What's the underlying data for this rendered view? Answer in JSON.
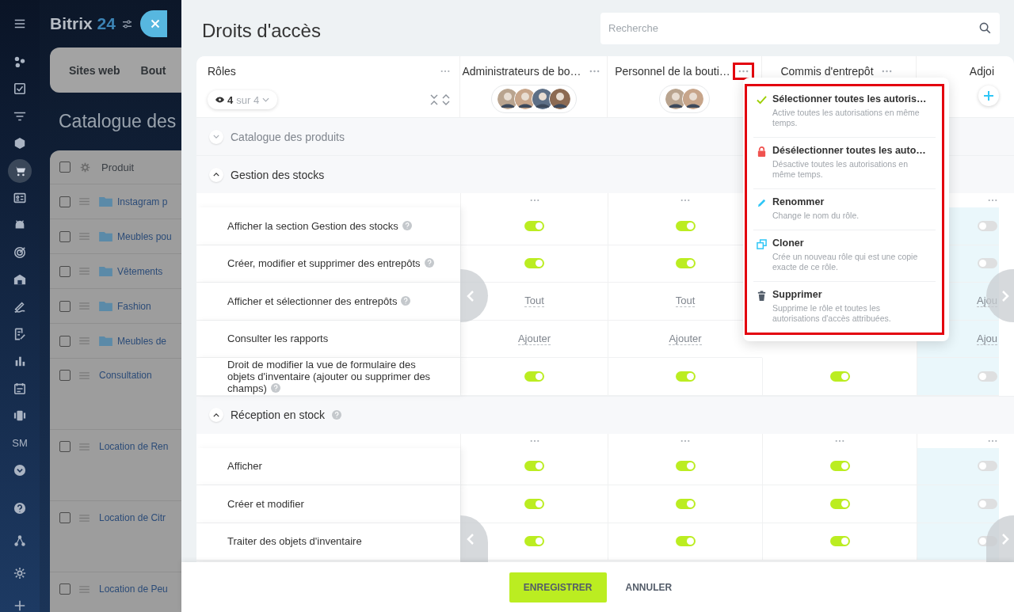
{
  "sidebar": {
    "groups": [
      [
        {
          "kind": "menu",
          "selected": false
        }
      ],
      [
        {
          "kind": "dots",
          "selected": false
        },
        {
          "kind": "task",
          "selected": false
        },
        {
          "kind": "funnel",
          "selected": false
        },
        {
          "kind": "cube",
          "selected": false
        },
        {
          "kind": "cart",
          "selected": true
        },
        {
          "kind": "contact",
          "selected": false
        },
        {
          "kind": "robot",
          "selected": false
        },
        {
          "kind": "target",
          "selected": false
        },
        {
          "kind": "building",
          "selected": false
        },
        {
          "kind": "signature",
          "selected": false
        },
        {
          "kind": "document",
          "selected": false
        },
        {
          "kind": "chart",
          "selected": false
        },
        {
          "kind": "calendar",
          "selected": false
        },
        {
          "kind": "video",
          "selected": false
        },
        {
          "kind": "text",
          "label": "SM",
          "selected": false
        },
        {
          "kind": "chevron",
          "selected": false
        }
      ],
      [
        {
          "kind": "help",
          "selected": false
        },
        {
          "kind": "network",
          "selected": false
        },
        {
          "kind": "settings",
          "selected": false
        },
        {
          "kind": "plus",
          "selected": false
        }
      ]
    ]
  },
  "page": {
    "logo": "Bitrix",
    "logo_number": "24",
    "tabs": [
      "Sites web",
      "Bout"
    ],
    "title": "Catalogue des",
    "table": {
      "header": "Produit",
      "all_checked": false,
      "rows": [
        {
          "name": "Instagram p",
          "kind": "folder",
          "checked": false
        },
        {
          "name": "Meubles pou",
          "kind": "folder",
          "checked": false
        },
        {
          "name": "Vêtements",
          "kind": "folder",
          "checked": false
        },
        {
          "name": "Fashion",
          "kind": "folder",
          "checked": false
        },
        {
          "name": "Meubles de",
          "kind": "folder",
          "checked": false
        },
        {
          "name": "Consultation",
          "kind": "product",
          "checked": false
        },
        {
          "name": "Location de Ren",
          "kind": "product",
          "checked": false
        },
        {
          "name": "Location de Citr",
          "kind": "product",
          "checked": false
        },
        {
          "name": "Location de Peu",
          "kind": "product",
          "checked": false
        }
      ]
    }
  },
  "panel": {
    "title": "Droits d'accès",
    "search": {
      "placeholder": "Recherche"
    },
    "roles_header": {
      "label": "Rôles",
      "count": "4",
      "total": "sur 4"
    },
    "roles": [
      {
        "name": "Administrateurs de bo…",
        "kind": "members",
        "highlighted": false,
        "tinted": false
      },
      {
        "name": "Personnel de la bouti…",
        "kind": "members",
        "highlighted": true,
        "tinted": false
      },
      {
        "name": "Commis d'entrepôt",
        "kind": "hidden",
        "highlighted": false,
        "tinted": false
      },
      {
        "name": "Adjoi",
        "kind": "empty",
        "tinted": true
      }
    ],
    "sections": [
      {
        "title": "Catalogue des produits",
        "expanded": false,
        "help": false
      },
      {
        "title": "Gestion des stocks",
        "expanded": true,
        "help": false,
        "rows": [
          {
            "label": "Afficher la section Gestion des stocks",
            "help": true,
            "cells": [
              {
                "kind": "toggle",
                "on": true
              },
              {
                "kind": "toggle",
                "on": true
              },
              null,
              {
                "kind": "toggle",
                "on": false
              }
            ]
          },
          {
            "label": "Créer, modifier et supprimer des entrepôts",
            "help": true,
            "cells": [
              {
                "kind": "toggle",
                "on": true
              },
              {
                "kind": "toggle",
                "on": true
              },
              null,
              {
                "kind": "toggle",
                "on": false
              }
            ]
          },
          {
            "label": "Afficher et sélectionner des entrepôts",
            "help": true,
            "cells": [
              {
                "kind": "link",
                "text": "Tout"
              },
              {
                "kind": "link",
                "text": "Tout"
              },
              null,
              {
                "kind": "link",
                "text": "Ajou"
              }
            ]
          },
          {
            "label": "Consulter les rapports",
            "help": false,
            "cells": [
              {
                "kind": "link",
                "text": "Ajouter"
              },
              {
                "kind": "link",
                "text": "Ajouter"
              },
              null,
              {
                "kind": "link",
                "text": "Ajou"
              }
            ]
          },
          {
            "label": "Droit de modifier la vue de formulaire des objets d'inventaire (ajouter ou supprimer des champs)",
            "help": true,
            "cells": [
              {
                "kind": "toggle",
                "on": true
              },
              {
                "kind": "toggle",
                "on": true
              },
              {
                "kind": "toggle",
                "on": true
              },
              {
                "kind": "toggle",
                "on": false
              }
            ]
          }
        ]
      },
      {
        "title": "Réception en stock",
        "expanded": true,
        "help": true,
        "rows": [
          {
            "label": "Afficher",
            "help": false,
            "cells": [
              {
                "kind": "toggle",
                "on": true
              },
              {
                "kind": "toggle",
                "on": true
              },
              {
                "kind": "toggle",
                "on": true
              },
              {
                "kind": "toggle",
                "on": false
              }
            ]
          },
          {
            "label": "Créer et modifier",
            "help": false,
            "cells": [
              {
                "kind": "toggle",
                "on": true
              },
              {
                "kind": "toggle",
                "on": true
              },
              {
                "kind": "toggle",
                "on": true
              },
              {
                "kind": "toggle",
                "on": false
              }
            ]
          },
          {
            "label": "Traiter des objets d'inventaire",
            "help": false,
            "cells": [
              {
                "kind": "toggle",
                "on": true
              },
              {
                "kind": "toggle",
                "on": true
              },
              {
                "kind": "toggle",
                "on": true
              },
              {
                "kind": "toggle",
                "on": false
              }
            ]
          }
        ]
      }
    ],
    "menu": {
      "highlighted": true,
      "items": [
        {
          "kind": "check",
          "title": "Sélectionner toutes les autoris…",
          "description": "Active toutes les autorisations en même temps."
        },
        {
          "kind": "lock",
          "title": "Désélectionner toutes les auto…",
          "description": "Désactive toutes les autorisations en même temps."
        },
        {
          "kind": "pencil",
          "title": "Renommer",
          "description": "Change le nom du rôle."
        },
        {
          "kind": "copy",
          "title": "Cloner",
          "description": "Crée un nouveau rôle qui est une copie exacte de ce rôle."
        },
        {
          "kind": "trash",
          "title": "Supprimer",
          "description": "Supprime le rôle et toutes les autorisations d'accès attribuées."
        }
      ]
    },
    "footer": {
      "buttons": [
        {
          "label": "ENREGISTRER",
          "kind": "primary"
        },
        {
          "label": "ANNULER",
          "kind": "plain"
        }
      ]
    }
  }
}
